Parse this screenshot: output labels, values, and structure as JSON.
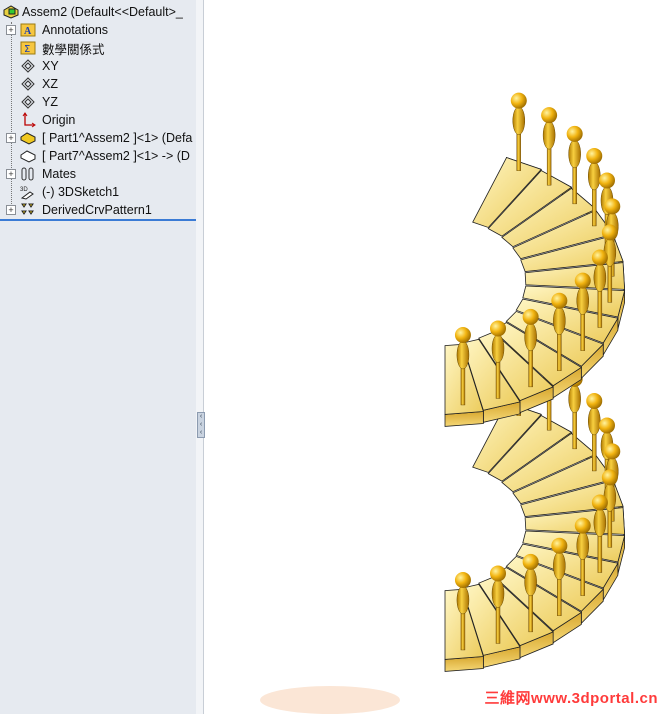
{
  "tree": {
    "root": "Assem2  (Default<<Default>_",
    "items": [
      {
        "label": "Annotations",
        "icon": "annotations-icon",
        "expandable": true
      },
      {
        "label": "數學關係式",
        "icon": "equations-icon",
        "expandable": false
      },
      {
        "label": "XY",
        "icon": "plane-icon",
        "expandable": false
      },
      {
        "label": "XZ",
        "icon": "plane-icon",
        "expandable": false
      },
      {
        "label": "YZ",
        "icon": "plane-icon",
        "expandable": false
      },
      {
        "label": "Origin",
        "icon": "origin-icon",
        "expandable": false
      },
      {
        "label": "[ Part1^Assem2 ]<1> (Defa",
        "icon": "part-icon",
        "expandable": true
      },
      {
        "label": "[ Part7^Assem2 ]<1> -> (D",
        "icon": "part-outline-icon",
        "expandable": false
      },
      {
        "label": "Mates",
        "icon": "mates-icon",
        "expandable": true
      },
      {
        "label": "(-) 3DSketch1",
        "icon": "3dsketch-icon",
        "expandable": false
      },
      {
        "label": "DerivedCrvPattern1",
        "icon": "pattern-icon",
        "expandable": true
      }
    ]
  },
  "colors": {
    "stair": "#f2d36a",
    "stair_dark": "#b88a1c",
    "accent": "#3a7bd5"
  },
  "watermark": "三維网www.3dportal.cn"
}
